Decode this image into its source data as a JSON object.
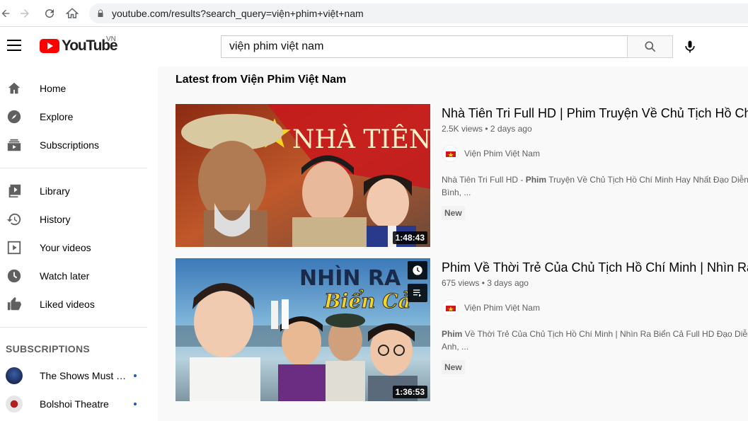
{
  "browser": {
    "url": "youtube.com/results?search_query=viện+phim+việt+nam"
  },
  "header": {
    "logo_text": "YouTube",
    "country": "VN",
    "search_value": "viện phim việt nam"
  },
  "sidebar": {
    "items": [
      {
        "label": "Home",
        "icon": "home-icon"
      },
      {
        "label": "Explore",
        "icon": "explore-icon"
      },
      {
        "label": "Subscriptions",
        "icon": "subscriptions-icon"
      }
    ],
    "library_items": [
      {
        "label": "Library",
        "icon": "library-icon"
      },
      {
        "label": "History",
        "icon": "history-icon"
      },
      {
        "label": "Your videos",
        "icon": "your-videos-icon"
      },
      {
        "label": "Watch later",
        "icon": "watch-later-icon"
      },
      {
        "label": "Liked videos",
        "icon": "liked-icon"
      }
    ],
    "subscriptions_heading": "SUBSCRIPTIONS",
    "subscriptions": [
      {
        "name": "The Shows Must Go On",
        "avatar_color": "#1c2a4a"
      },
      {
        "name": "Bolshoi Theatre",
        "avatar_color": "#c8c8c8"
      }
    ]
  },
  "main": {
    "section_title": "Latest from Viện Phim Việt Nam",
    "videos": [
      {
        "title": "Nhà Tiên Tri Full HD | Phim Truyện Về Chủ Tịch Hồ Chí Minh Hay Nhất",
        "views": "2.5K views",
        "age": "2 days ago",
        "channel": "Viện Phim Việt Nam",
        "desc_line1_prefix": "Nhà Tiên Tri Full HD - ",
        "desc_line1_bold": "Phim",
        "desc_line1_rest": " Truyện Về Chủ Tịch Hồ Chí Minh Hay Nhất Đạo Diễn",
        "desc_line2": "Bình, ...",
        "badge": "New",
        "duration": "1:48:43",
        "thumb_text": "NHÀ TIÊN TRI"
      },
      {
        "title": "Phim Về Thời Trẻ Của Chủ Tịch Hồ Chí Minh | Nhìn Ra Biển Cả Full HD",
        "views": "675 views",
        "age": "3 days ago",
        "channel": "Viện Phim Việt Nam",
        "desc_line1_bold": "Phim",
        "desc_line1_rest": " Về Thời Trẻ Của Chủ Tịch Hồ Chí Minh | Nhìn Ra Biển Cả Full HD Đạo Diễn",
        "desc_line2": "Anh, ...",
        "badge": "New",
        "duration": "1:36:53",
        "thumb_text_1": "NHÌN RA",
        "thumb_text_2": "Biển Cả"
      }
    ]
  }
}
